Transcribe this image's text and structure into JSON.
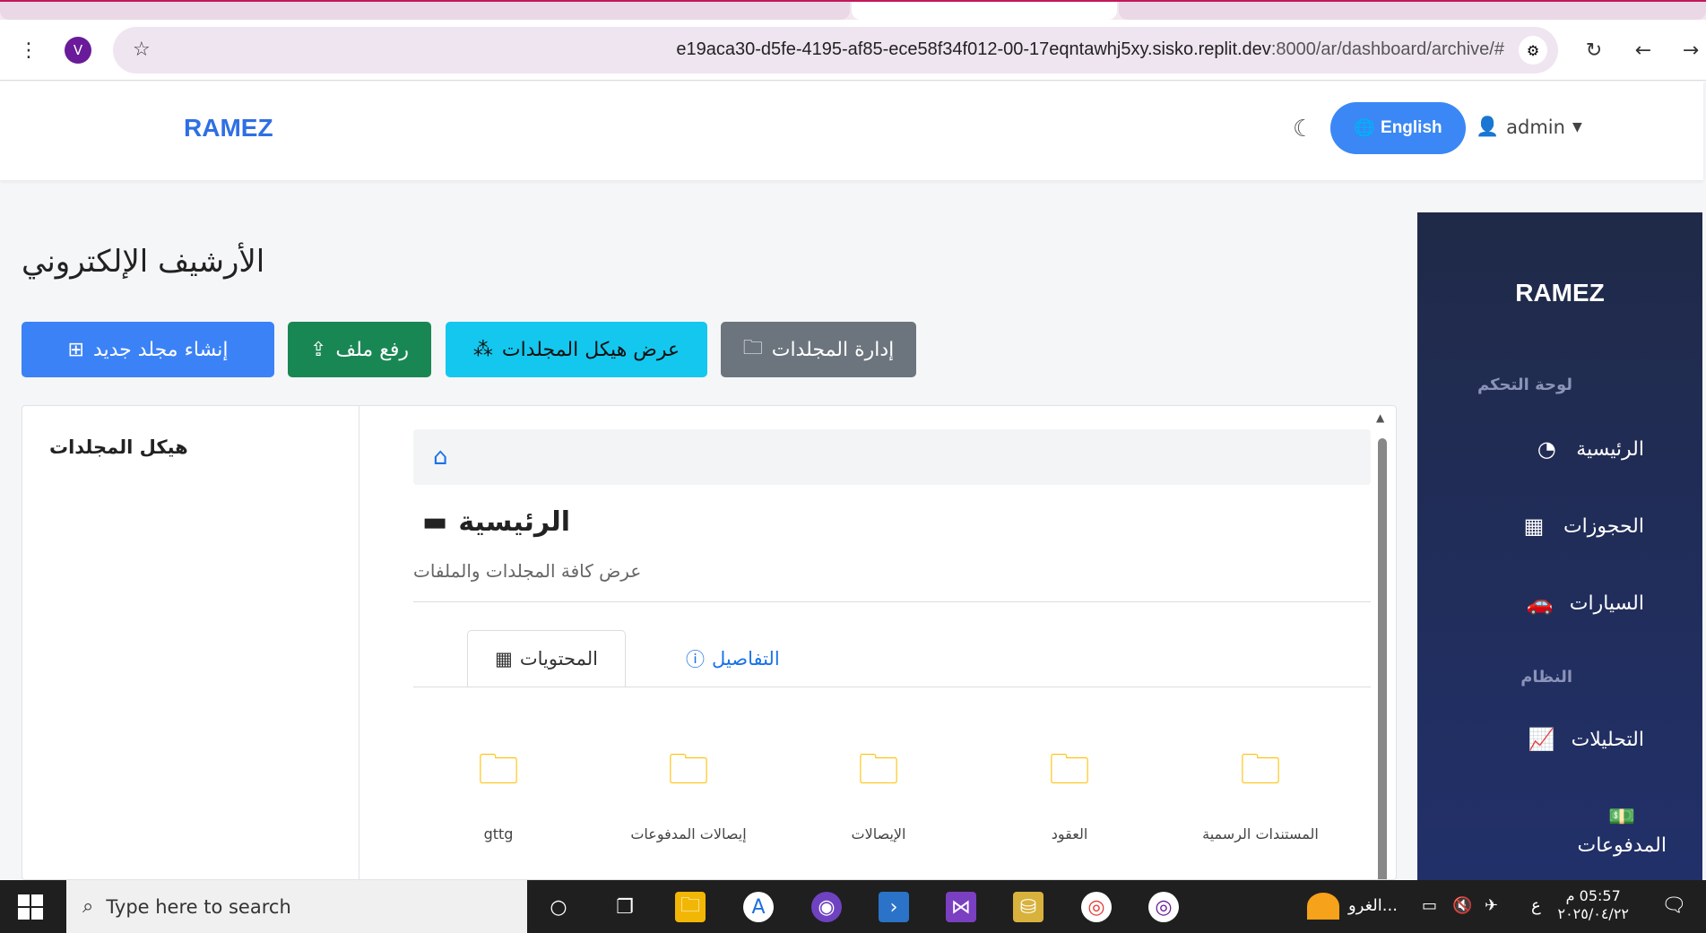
{
  "browser": {
    "avatar_letter": "V",
    "url_main": "e19aca30-d5fe-4195-af85-ece58f34f012-00-17eqntawhj5xy.sisko.replit.dev",
    "url_rest": ":8000/ar/dashboard/archive/#"
  },
  "header": {
    "brand": "RAMEZ",
    "language_button": "English",
    "user_name": "admin"
  },
  "sidebar": {
    "brand": "RAMEZ",
    "section_dashboard": "لوحة التحكم",
    "section_system": "النظام",
    "items": [
      {
        "label": "الرئيسية",
        "icon": "gauge-icon"
      },
      {
        "label": "الحجوزات",
        "icon": "calendar-icon"
      },
      {
        "label": "السيارات",
        "icon": "car-icon"
      },
      {
        "label": "التحليلات",
        "icon": "chart-line-icon"
      },
      {
        "label": "المدفوعات",
        "icon": "money-icon"
      }
    ]
  },
  "page": {
    "title": "الأرشيف الإلكتروني",
    "buttons": {
      "new_folder": "إنشاء مجلد جديد",
      "upload": "رفع ملف",
      "tree": "عرض هيكل المجلدات",
      "manage": "إدارة المجلدات"
    },
    "tree_title": "هيكل المجلدات",
    "folder_title": "الرئيسية",
    "folder_subtitle": "عرض كافة المجلدات والملفات",
    "tabs": {
      "contents": "المحتويات",
      "details": "التفاصيل"
    },
    "folders": [
      "المستندات الرسمية",
      "العقود",
      "الإيصالات",
      "إيصالات المدفوعات",
      "gttg"
    ]
  },
  "taskbar": {
    "search_placeholder": "Type here to search",
    "weather_text": "الغرو...",
    "lang_indicator": "ع",
    "time": "05:57 م",
    "date": "٢٠٢٥/٠٤/٢٢"
  },
  "colors": {
    "primary": "#3b82f6",
    "success": "#198754",
    "info": "#14c7ee",
    "secondary": "#6c757d",
    "sidebar": "#1f2a48",
    "folder": "#ffc107"
  }
}
